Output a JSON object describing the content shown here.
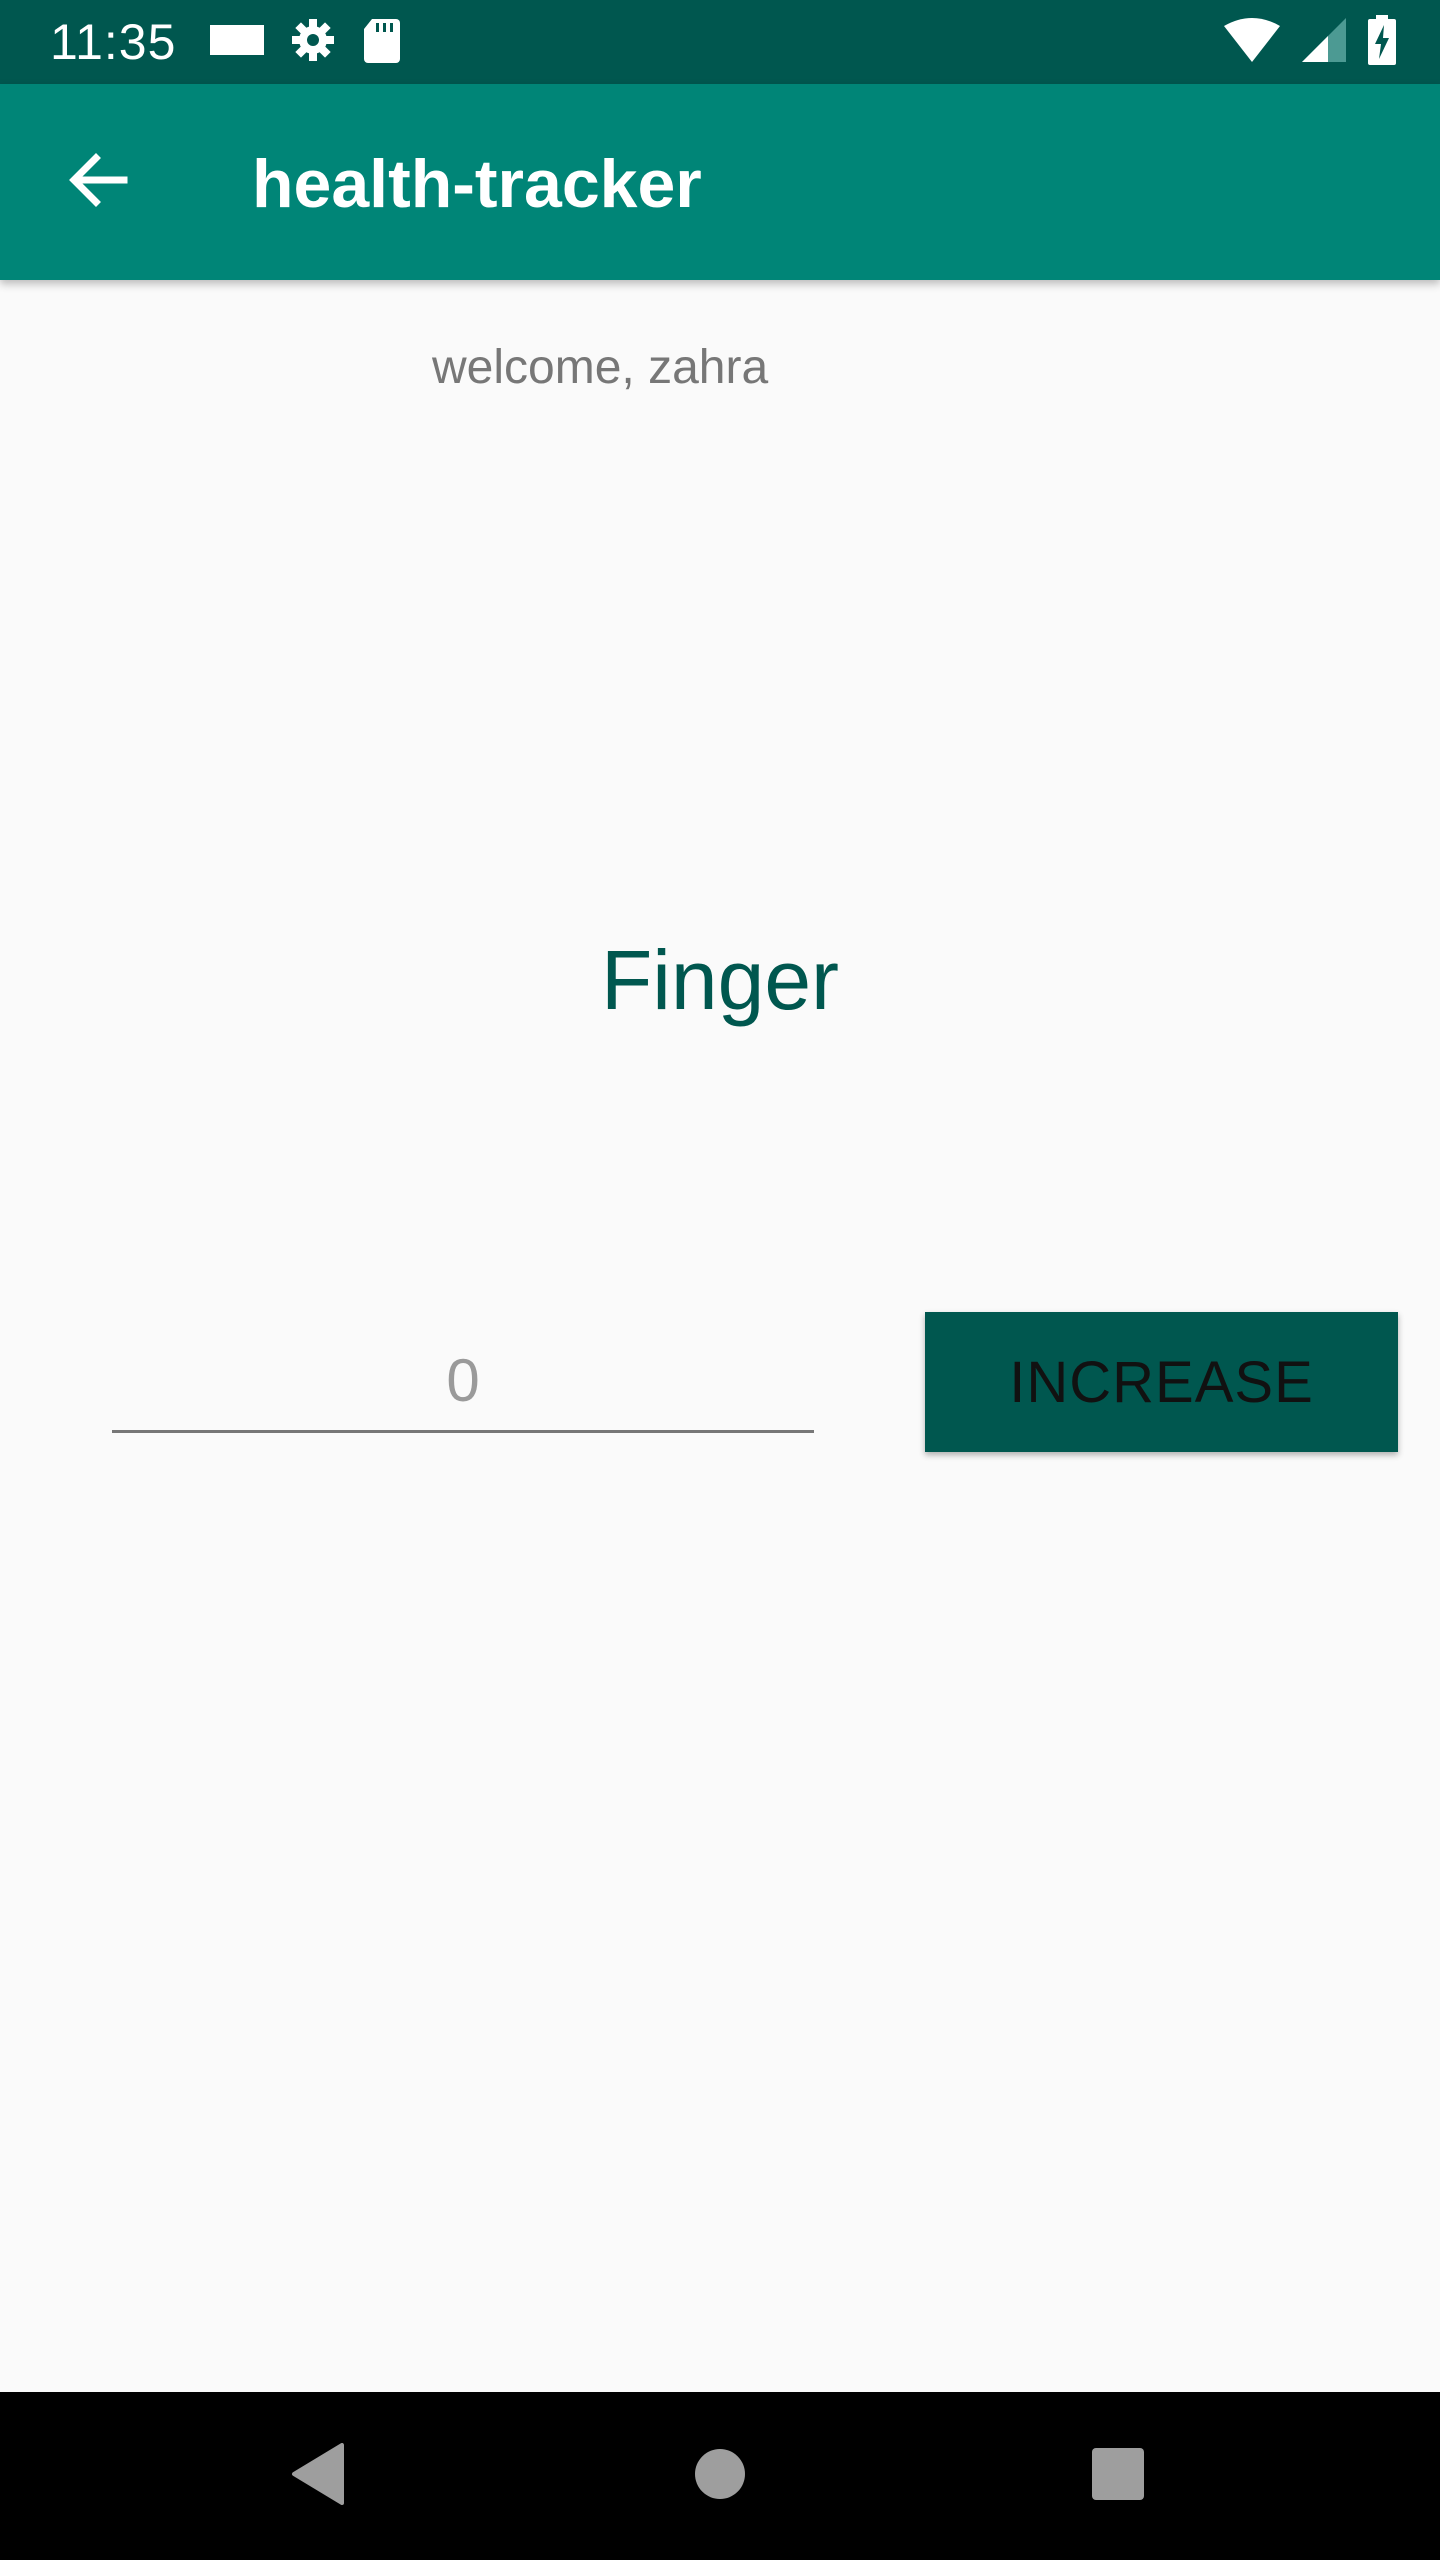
{
  "status_bar": {
    "time": "11:35",
    "left_icons": [
      "notification-card-icon",
      "settings-gear-icon",
      "sd-card-icon"
    ],
    "right_icons": [
      "wifi-icon",
      "cell-signal-icon",
      "battery-charging-icon"
    ],
    "background_color": "#00574f"
  },
  "app_bar": {
    "title": "health-tracker",
    "back_icon": "arrow-back-icon",
    "background_color": "#008577"
  },
  "main": {
    "welcome": "welcome, zahra",
    "title": "Finger",
    "count_field": {
      "placeholder": "0",
      "value": ""
    },
    "increase_label": "INCREASE",
    "accent_color": "#00574f"
  },
  "nav_bar": {
    "buttons": [
      "back-triangle-icon",
      "home-circle-icon",
      "recents-square-icon"
    ]
  }
}
